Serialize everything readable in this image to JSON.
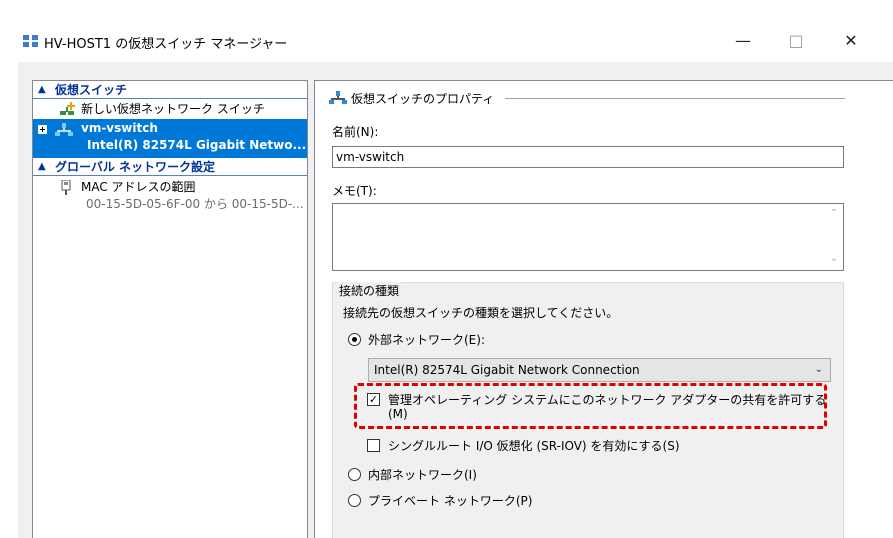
{
  "window": {
    "title": "HV-HOST1 の仮想スイッチ マネージャー",
    "minimize": "—",
    "maximize": "□",
    "close": "✕"
  },
  "left": {
    "section_switches": "仮想スイッチ",
    "new_switch": "新しい仮想ネットワーク スイッチ",
    "selected_switch_name": "vm-vswitch",
    "selected_switch_adapter": "Intel(R) 82574L Gigabit Netwo...",
    "section_global": "グローバル ネットワーク設定",
    "mac_title": "MAC アドレスの範囲",
    "mac_range": "00-15-5D-05-6F-00 から 00-15-5D-..."
  },
  "right": {
    "group_title": "仮想スイッチのプロパティ",
    "name_label": "名前(N):",
    "name_value": "vm-vswitch",
    "memo_label": "メモ(T):",
    "conn_type_title": "接続の種類",
    "conn_type_desc": "接続先の仮想スイッチの種類を選択してください。",
    "external": "外部ネットワーク(E):",
    "adapter_selected": "Intel(R) 82574L Gigabit Network Connection",
    "allow_mgmt_line1": "管理オペレーティング システムにこのネットワーク アダプターの共有を許可する",
    "allow_mgmt_line2": "(M)",
    "sriov": "シングルルート I/O 仮想化 (SR-IOV) を有効にする(S)",
    "internal": "内部ネットワーク(I)",
    "private": "プライベート ネットワーク(P)"
  },
  "colors": {
    "selection": "#0078d7",
    "link_header": "#003399",
    "highlight": "#e00000"
  }
}
